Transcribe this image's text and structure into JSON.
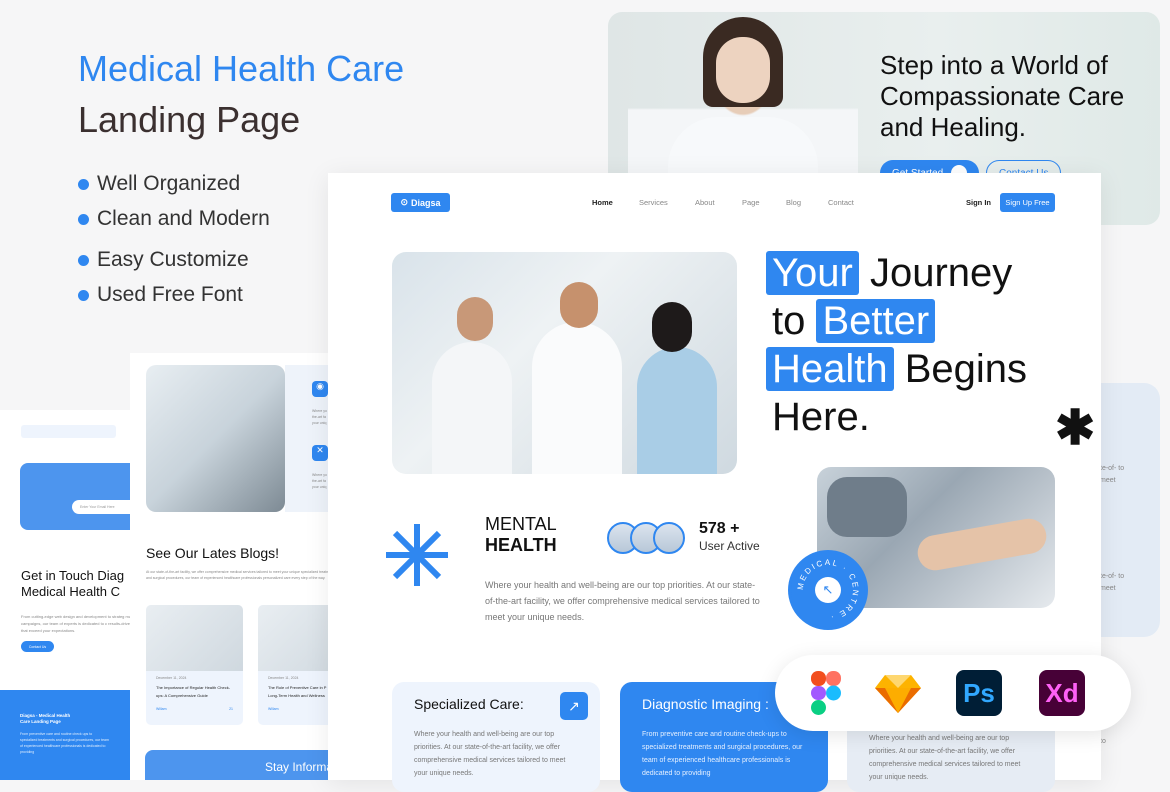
{
  "showcase": {
    "title_line1": "Medical Health Care",
    "title_line2": "Landing Page",
    "features": [
      "Well Organized",
      "Clean and Modern",
      "Easy Customize",
      "Used Free Font"
    ]
  },
  "preview_top": {
    "headline": "Step into a World of Compassionate Care and Healing.",
    "get_started": "Get Started",
    "contact_us": "Contact Us"
  },
  "main": {
    "logo": "Diagsa",
    "nav": [
      "Home",
      "Services",
      "About",
      "Page",
      "Blog",
      "Contact"
    ],
    "sign_in": "Sign In",
    "sign_up": "Sign Up Free",
    "hero": {
      "w1": "Your",
      "w2": "Journey",
      "w3": "to",
      "w4": "Better",
      "w5": "Health",
      "w6": "Begins",
      "w7": "Here."
    },
    "mental_1": "MENTAL",
    "mental_2": "HEALTH",
    "users_count": "578 +",
    "users_label": "User Active",
    "description": "Where your health and well-being are our top priorities. At our state-of-the-art facility, we offer comprehensive medical services tailored to meet your unique needs.",
    "badge": "MEDICAL · CENTRE ·",
    "cards": [
      {
        "title": "Specialized Care:",
        "text": "Where your health and well-being are our top priorities. At our state-of-the-art facility, we offer comprehensive medical services tailored to meet your unique needs."
      },
      {
        "title": "Diagnostic Imaging :",
        "text": "From preventive care and routine check-ups to specialized treatments and surgical procedures, our team of experienced healthcare professionals is dedicated to providing"
      },
      {
        "text": "Where your health and well-being are our top priorities. At our state-of-the-art facility, we offer comprehensive medical services tailored to meet your unique needs."
      }
    ]
  },
  "tools": {
    "ps": "Ps",
    "xd": "Xd"
  },
  "blog_page": {
    "title": "See Our Lates Blogs!",
    "intro": "At our state-of-the-art facility, we offer comprehensive medical services tailored to meet your unique specialized treatments and surgical procedures, our team of experienced healthcare professionals personalized care every step of the way.",
    "posts": [
      {
        "date": "December 11, 2024",
        "title": "The Importance of Regular Health Check-ups: A Comprehensive Guide",
        "author": "Willam",
        "comments": "21"
      },
      {
        "date": "December 11, 2024",
        "title": "The Role of Preventive Care in P Long-Term Health and Wellness",
        "author": "Willam"
      }
    ],
    "side_text": "Where yo the-art fa your uniq",
    "newsletter": "Stay Informa"
  },
  "contact_page": {
    "email_placeholder": "Enter Your Email Here",
    "title": "Get in Touch Diag Medical Health C",
    "text": "From cutting-edge web design and development to strateg marketing campaigns, our team of experts is dedicated to c results-driven solutions that exceed your expectations.",
    "contact_btn": "Contact Us",
    "footer_title": "Diagsa - Medical Health Care Landing Page",
    "footer_text": "From preventive care and routine check ups to specialized treatments and surgical procedures, our team of experienced healthcare professionals is dedicated to providing"
  },
  "right_page": {
    "t1": "te-of- to meet",
    "t2": "te-of- to meet",
    "t3": "to"
  },
  "colors": {
    "accent": "#2f87f0",
    "dark": "#111111"
  }
}
